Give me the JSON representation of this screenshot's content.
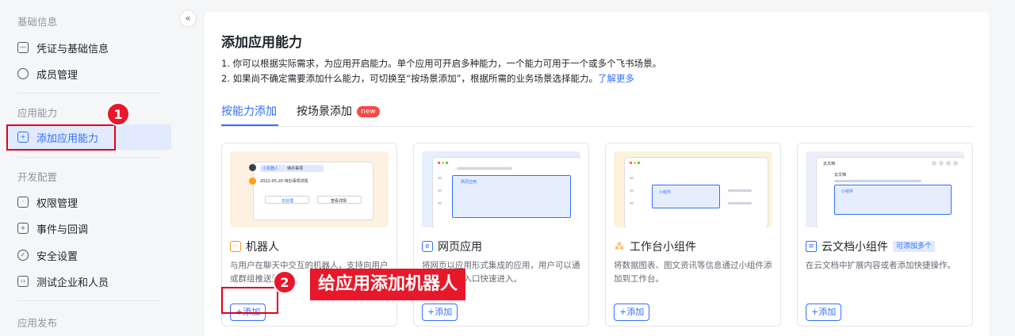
{
  "sidebar": {
    "sections": [
      {
        "title": "基础信息",
        "items": [
          {
            "label": "凭证与基础信息",
            "icon": "credential-icon"
          },
          {
            "label": "成员管理",
            "icon": "member-icon"
          }
        ]
      },
      {
        "title": "应用能力",
        "items": [
          {
            "label": "添加应用能力",
            "icon": "add-capability-icon",
            "active": true
          }
        ]
      },
      {
        "title": "开发配置",
        "items": [
          {
            "label": "权限管理",
            "icon": "permission-icon"
          },
          {
            "label": "事件与回调",
            "icon": "event-icon"
          },
          {
            "label": "安全设置",
            "icon": "security-icon"
          },
          {
            "label": "测试企业和人员",
            "icon": "test-org-icon"
          }
        ]
      },
      {
        "title": "应用发布",
        "items": []
      }
    ],
    "collapse_icon": "«"
  },
  "main": {
    "title": "添加应用能力",
    "desc_line1": "1. 你可以根据实际需求，为应用开启能力。单个应用可开启多种能力，一个能力可用于一个或多个飞书场景。",
    "desc_line2": "2. 如果尚不确定需要添加什么能力，可切换至“按场景添加”，根据所需的业务场景选择能力。",
    "desc_link": "了解更多",
    "tabs": [
      {
        "label": "按能力添加",
        "active": true
      },
      {
        "label": "按场景添加",
        "badge": "new"
      }
    ],
    "cards": [
      {
        "title": "机器人",
        "icon": "robot-icon",
        "desc": "与用户在聊天中交互的机器人，支持向用户或群组推送消息。",
        "button": "+添加",
        "preview_bg": "#fdf1e1",
        "preview_text": [
          "小机器人",
          "待办事项",
          "2022-05-20 待办事项详情",
          "去处理",
          "查看详情"
        ]
      },
      {
        "title": "网页应用",
        "icon": "web-app-icon",
        "desc": "将网页以应用形式集成的应用，用户可以通过工作台等入口快速进入。",
        "button": "+添加",
        "preview_bg": "#e8eefc",
        "preview_text": [
          "网页应用"
        ]
      },
      {
        "title": "工作台小组件",
        "icon": "widget-icon",
        "desc": "将数据图表、图文资讯等信息通过小组件添加到工作台。",
        "button": "+添加",
        "preview_bg": "#fdf3dc",
        "preview_text": [
          "小组件"
        ]
      },
      {
        "title": "云文档小组件",
        "icon": "doc-widget-icon",
        "tag": "可添加多个",
        "desc": "在云文档中扩展内容或者添加快捷操作。",
        "button": "+添加",
        "preview_bg": "#eceffa",
        "preview_text": [
          "云文档",
          "云文档",
          "小组件"
        ]
      }
    ]
  },
  "annotations": {
    "step1": "1",
    "step2": "2",
    "step2_label": "给应用添加机器人",
    "color": "#e8182a"
  }
}
